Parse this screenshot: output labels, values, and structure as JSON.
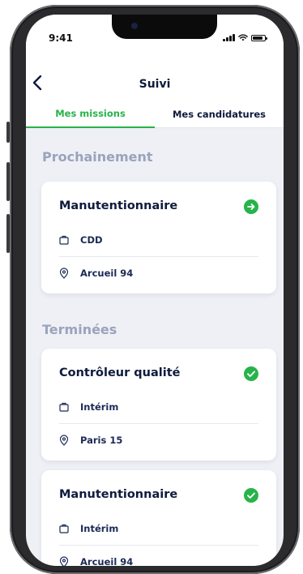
{
  "status_bar": {
    "time": "9:41"
  },
  "header": {
    "title": "Suivi"
  },
  "tabs": [
    {
      "label": "Mes missions",
      "active": true
    },
    {
      "label": "Mes candidatures",
      "active": false
    }
  ],
  "sections": {
    "upcoming": {
      "title": "Prochainement",
      "cards": [
        {
          "title": "Manutentionnaire",
          "status_icon": "arrow-right-circle-icon",
          "contract": "CDD",
          "location": "Arcueil 94"
        }
      ]
    },
    "finished": {
      "title": "Terminées",
      "cards": [
        {
          "title": "Contrôleur qualité",
          "status_icon": "check-circle-icon",
          "contract": "Intérim",
          "location": "Paris 15"
        },
        {
          "title": "Manutentionnaire",
          "status_icon": "check-circle-icon",
          "contract": "Intérim",
          "location": "Arcueil 94"
        }
      ]
    }
  },
  "colors": {
    "accent_green": "#27b34a",
    "navy_text": "#0f1b3d",
    "section_gray": "#9aa3bb",
    "background": "#eef0f5"
  }
}
